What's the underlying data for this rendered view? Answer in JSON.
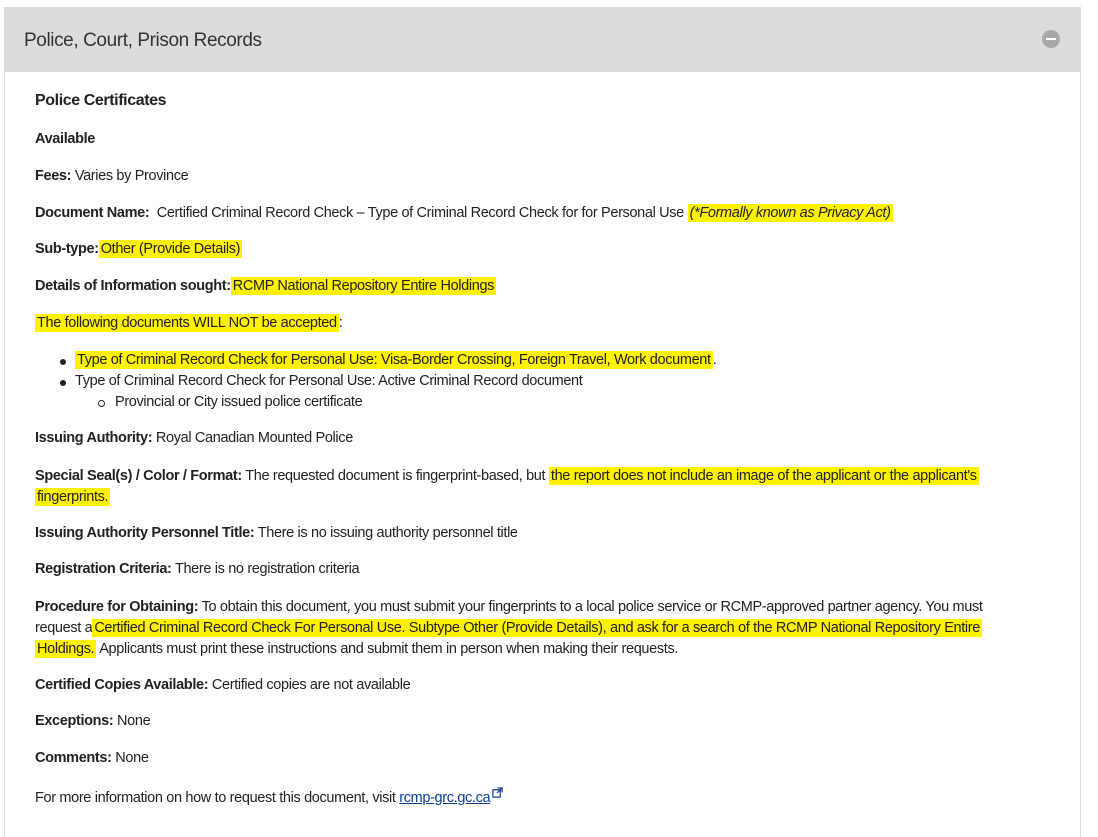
{
  "header": {
    "title": "Police, Court, Prison Records"
  },
  "section": {
    "heading": "Police Certificates",
    "availability": "Available",
    "fees": {
      "label": "Fees:",
      "value": "Varies by Province"
    },
    "document_name": {
      "label": "Document Name:",
      "value": "Certified Criminal Record Check – Type of Criminal Record Check for for Personal Use",
      "note": "(*Formally known as Privacy Act)"
    },
    "subtype": {
      "label": "Sub-type:",
      "value": "Other (Provide Details)"
    },
    "details": {
      "label": "Details of Information sought:",
      "value": "RCMP National Repository Entire Holdings"
    },
    "not_accepted": {
      "intro": "The following documents WILL NOT be accepted",
      "intro_suffix": ":",
      "item1": "Type of Criminal Record Check for Personal Use: Visa-Border Crossing, Foreign Travel, Work document",
      "item1_suffix": ".",
      "item2": "Type of Criminal Record Check for Personal Use: Active Criminal Record document",
      "item2_sub": "Provincial or City issued police certificate"
    },
    "issuing_authority": {
      "label": "Issuing Authority:",
      "value": "Royal Canadian Mounted Police"
    },
    "special_seal": {
      "label": "Special Seal(s) / Color / Format:",
      "value": "The requested document is fingerprint-based, but",
      "highlight_line1": "the report does not include an image of the applicant or the applicant's",
      "highlight_line2": "fingerprints."
    },
    "personnel_title": {
      "label": "Issuing Authority Personnel Title:",
      "value": "There is no issuing authority personnel title"
    },
    "registration": {
      "label": "Registration Criteria:",
      "value": "There is no registration criteria"
    },
    "procedure": {
      "label": "Procedure for Obtaining:",
      "line1": "To obtain this document, you must submit your fingerprints to a local police service or RCMP-approved partner agency. You must",
      "line2_pre": "request a",
      "highlight_line2": "Certified Criminal Record Check For Personal Use. Subtype Other (Provide Details), and ask for a search of the RCMP National Repository Entire",
      "highlight_line3": "Holdings.",
      "line3_post": "Applicants must print these instructions and submit them in person when making their requests."
    },
    "certified_copies": {
      "label": "Certified Copies Available:",
      "value": "Certified copies are not available"
    },
    "exceptions": {
      "label": "Exceptions:",
      "value": "None"
    },
    "comments": {
      "label": "Comments:",
      "value": "None"
    },
    "more_info": {
      "text": "For more information on how to request this document, visit",
      "link": "rcmp-grc.gc.ca"
    }
  },
  "colors": {
    "highlight": "#fff200",
    "header_bg": "#dcdcdc",
    "link": "#0b3d91"
  }
}
